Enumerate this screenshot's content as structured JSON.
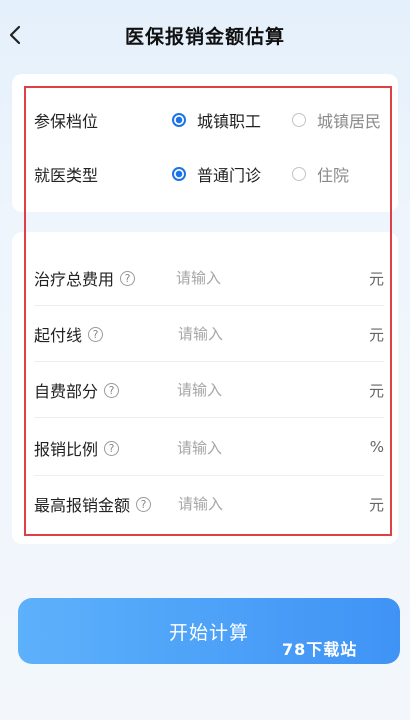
{
  "header": {
    "title": "医保报销金额估算",
    "back_icon": "chevron-left-icon"
  },
  "options": {
    "insurance": {
      "label": "参保档位",
      "choices": [
        "城镇职工",
        "城镇居民"
      ],
      "selected": 0
    },
    "visit": {
      "label": "就医类型",
      "choices": [
        "普通门诊",
        "住院"
      ],
      "selected": 0
    }
  },
  "fields": [
    {
      "label": "治疗总费用",
      "placeholder": "请输入",
      "unit": "元",
      "value": ""
    },
    {
      "label": "起付线",
      "placeholder": "请输入",
      "unit": "元",
      "value": ""
    },
    {
      "label": "自费部分",
      "placeholder": "请输入",
      "unit": "元",
      "value": ""
    },
    {
      "label": "报销比例",
      "placeholder": "请输入",
      "unit": "%",
      "value": ""
    },
    {
      "label": "最高报销金额",
      "placeholder": "请输入",
      "unit": "元",
      "value": ""
    }
  ],
  "help_glyph": "?",
  "button": {
    "label": "开始计算"
  },
  "watermark": "78下载站",
  "colors": {
    "accent": "#1a73e8",
    "button_gradient": [
      "#5db1fb",
      "#3f93f5"
    ],
    "highlight_border": "#e04044"
  }
}
